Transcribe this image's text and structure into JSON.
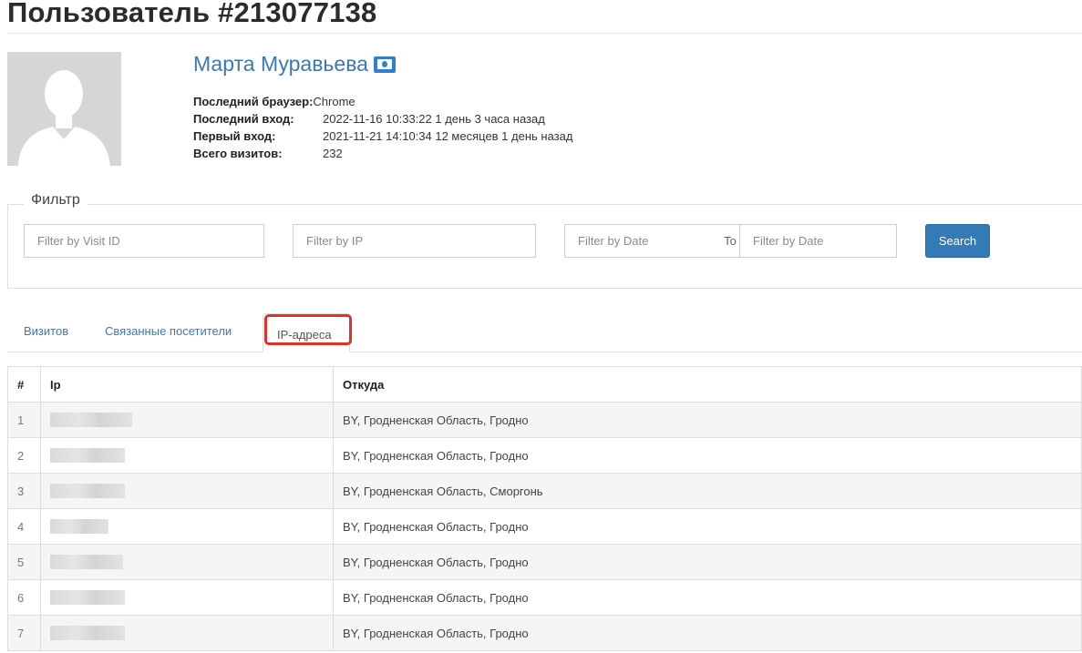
{
  "page": {
    "title": "Пользователь #213077138"
  },
  "user": {
    "name": "Марта Муравьева",
    "info": [
      {
        "label": "Последний браузер:",
        "value": "Chrome"
      },
      {
        "label": "Последний вход:",
        "value": "2022-11-16 10:33:22 1 день 3 часа назад"
      },
      {
        "label": "Первый вход:",
        "value": "2021-11-21 14:10:34 12 месяцев 1 день назад"
      },
      {
        "label": "Всего визитов:",
        "value": "232"
      }
    ]
  },
  "filter": {
    "legend": "Фильтр",
    "visit_id_placeholder": "Filter by Visit ID",
    "ip_placeholder": "Filter by IP",
    "date_from_placeholder": "Filter by Date",
    "to_label": "To",
    "date_to_placeholder": "Filter by Date",
    "search_label": "Search"
  },
  "tabs": [
    {
      "label": "Визитов",
      "active": false
    },
    {
      "label": "Связанные посетители",
      "active": false
    },
    {
      "label": "IP-адреса",
      "active": true
    }
  ],
  "table": {
    "headers": [
      "#",
      "Ip",
      "Откуда"
    ],
    "rows": [
      {
        "num": "1",
        "from": "BY, Гродненская Область, Гродно"
      },
      {
        "num": "2",
        "from": "BY, Гродненская Область, Гродно"
      },
      {
        "num": "3",
        "from": "BY, Гродненская Область, Сморгонь"
      },
      {
        "num": "4",
        "from": "BY, Гродненская Область, Гродно"
      },
      {
        "num": "5",
        "from": "BY, Гродненская Область, Гродно"
      },
      {
        "num": "6",
        "from": "BY, Гродненская Область, Гродно"
      },
      {
        "num": "7",
        "from": "BY, Гродненская Область, Гродно"
      }
    ]
  },
  "colors": {
    "link": "#3b79b3",
    "primary_button": "#337ab7",
    "highlight": "#e0302a",
    "stripe": "#f5f5f5"
  },
  "icons": {
    "avatar": "user-silhouette-icon",
    "badge": "id-card-icon"
  }
}
